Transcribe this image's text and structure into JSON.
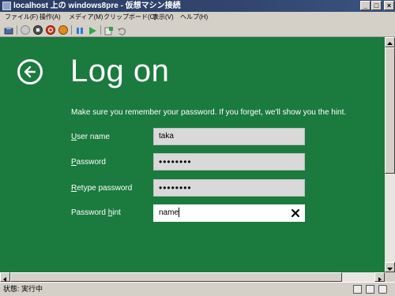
{
  "window": {
    "title": "localhost 上の windows8pre - 仮想マシン接続",
    "min": "_",
    "max": "□",
    "close": "×"
  },
  "menu": [
    "ファイル(F)",
    "操作(A)",
    "メディア(M)",
    "クリップボード(C)",
    "表示(V)",
    "ヘルプ(H)"
  ],
  "toolbar": {
    "icons": [
      "ctrl-alt-del-icon",
      "start-icon",
      "turn-off-icon",
      "shutdown-icon",
      "save-icon",
      "pause-icon",
      "resume-icon",
      "snapshot-icon",
      "revert-icon"
    ]
  },
  "logon": {
    "title": "Log on",
    "description": "Make sure you remember your password. If you forget, we'll show you the hint.",
    "fields": [
      {
        "label_accel": "U",
        "label_rest": "ser name",
        "value": "taka",
        "type": "text"
      },
      {
        "label_accel": "P",
        "label_rest": "assword",
        "value": "••••••••",
        "type": "password"
      },
      {
        "label_accel": "R",
        "label_rest": "etype password",
        "value": "••••••••",
        "type": "password"
      },
      {
        "label_prefix": "Password ",
        "label_accel": "h",
        "label_rest": "int",
        "value": "name",
        "type": "text"
      }
    ]
  },
  "status": {
    "text": "状態: 実行中"
  },
  "colors": {
    "screen_bg": "#1b7a3e",
    "titlebar": "#2a3d64"
  }
}
